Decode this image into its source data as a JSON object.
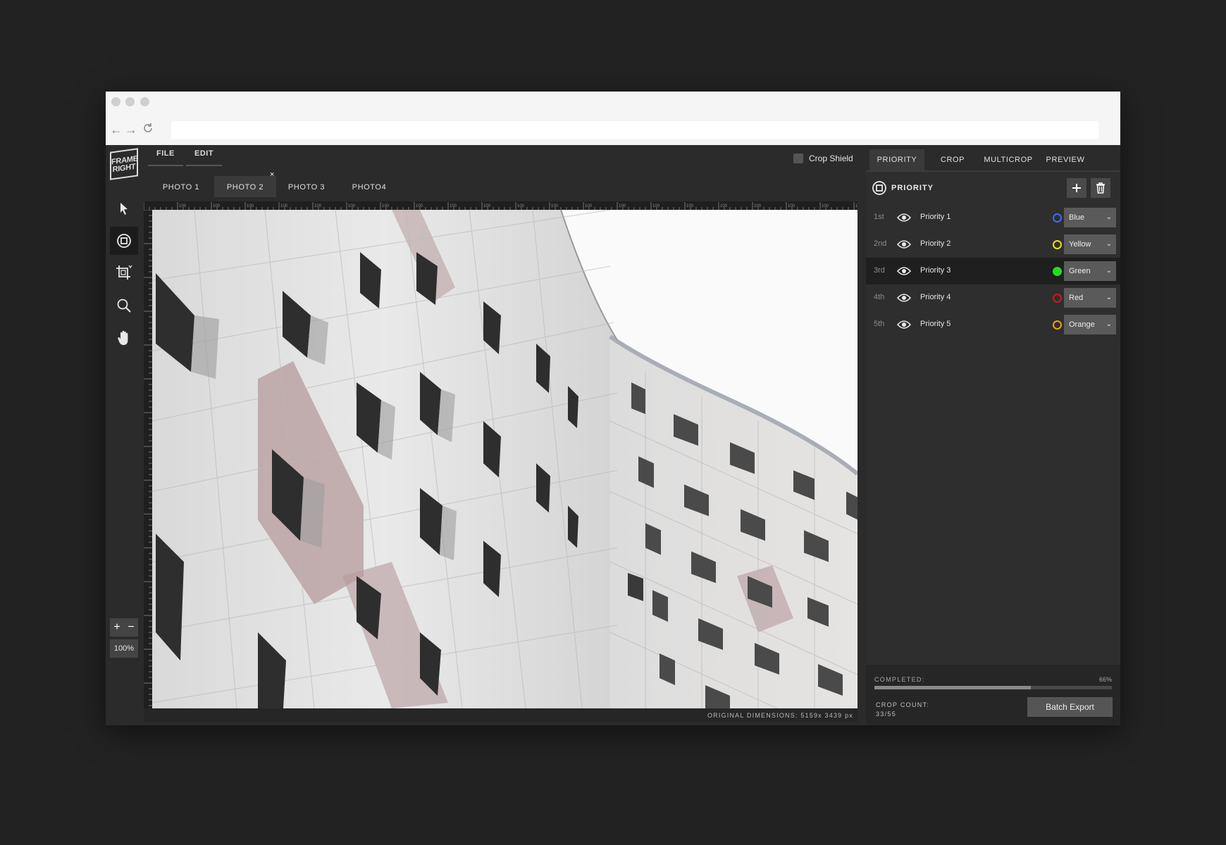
{
  "app": {
    "logo_text": "FRAME RIGHT",
    "menu": [
      {
        "label": "FILE"
      },
      {
        "label": "EDIT"
      }
    ],
    "crop_shield_label": "Crop Shield",
    "panel_tabs": [
      {
        "label": "PRIORITY",
        "active": true
      },
      {
        "label": "CROP",
        "active": false
      },
      {
        "label": "MULTICROP",
        "active": false
      },
      {
        "label": "PREVIEW",
        "active": false
      }
    ],
    "photo_tabs": [
      {
        "label": "PHOTO 1",
        "active": false
      },
      {
        "label": "PHOTO 2",
        "active": true
      },
      {
        "label": "PHOTO 3",
        "active": false
      },
      {
        "label": "PHOTO4",
        "active": false
      }
    ],
    "close_glyph": "×"
  },
  "tools": {
    "items": [
      {
        "name": "pointer-icon",
        "active": false
      },
      {
        "name": "priority-icon",
        "active": true
      },
      {
        "name": "crop-icon",
        "active": false
      },
      {
        "name": "search-icon",
        "active": false
      },
      {
        "name": "hand-icon",
        "active": false
      }
    ],
    "zoom_in": "+",
    "zoom_out": "−",
    "zoom_level": "100%"
  },
  "canvas": {
    "ruler_tick_label": "100",
    "dimensions_label": "ORIGINAL DIMENSIONS: 5159x 3439 px"
  },
  "priority_panel": {
    "title": "PRIORITY",
    "rows": [
      {
        "rank": "1st",
        "name": "Priority 1",
        "color_name": "Blue",
        "color": "#3b6cff",
        "filled": false,
        "selected": false
      },
      {
        "rank": "2nd",
        "name": "Priority 2",
        "color_name": "Yellow",
        "color": "#f1e10f",
        "filled": false,
        "selected": false
      },
      {
        "rank": "3rd",
        "name": "Priority 3",
        "color_name": "Green",
        "color": "#22dd22",
        "filled": true,
        "selected": true
      },
      {
        "rank": "4th",
        "name": "Priority 4",
        "color_name": "Red",
        "color": "#d11919",
        "filled": false,
        "selected": false
      },
      {
        "rank": "5th",
        "name": "Priority 5",
        "color_name": "Orange",
        "color": "#f0a10c",
        "filled": false,
        "selected": false
      }
    ],
    "footer": {
      "completed_label": "COMPLETED:",
      "completed_pct": "66%",
      "completed_value": 0.66,
      "crop_count_label": "CROP COUNT:",
      "crop_count_value": "33/55",
      "batch_export_label": "Batch Export"
    }
  }
}
